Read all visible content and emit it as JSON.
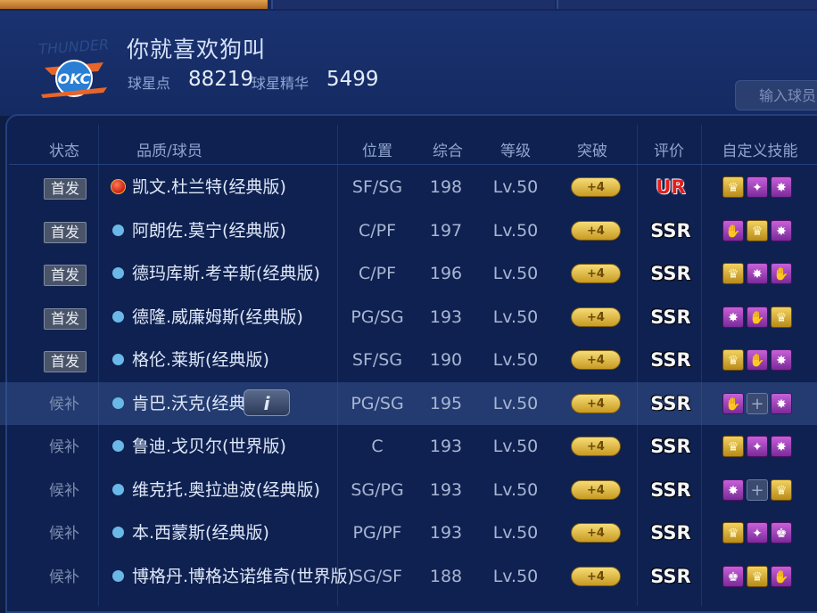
{
  "team": {
    "name": "你就喜欢狗叫",
    "logo_text": "THUNDER OKC",
    "stat1_label": "球星点",
    "stat1_value": "88219",
    "stat2_label": "球星精华",
    "stat2_value": "5499",
    "search_placeholder": "输入球员"
  },
  "columns": [
    "状态",
    "品质/球员",
    "位置",
    "综合",
    "等级",
    "突破",
    "评价",
    "自定义技能"
  ],
  "rows": [
    {
      "status": "首发",
      "quality": "red",
      "name": "凯文.杜兰特(经典版)",
      "pos": "SF/SG",
      "ovr": "198",
      "level": "Lv.50",
      "breakthrough": "+4",
      "rating": "UR",
      "skills": [
        "gold-crown-skill-icon",
        "purple-dunk-skill-icon",
        "purple-dribble-skill-icon"
      ]
    },
    {
      "status": "首发",
      "quality": "blue",
      "name": "阿朗佐.莫宁(经典版)",
      "pos": "C/PF",
      "ovr": "197",
      "level": "Lv.50",
      "breakthrough": "+4",
      "rating": "SSR",
      "skills": [
        "purple-block-skill-icon",
        "gold-crown-skill-icon",
        "purple-dribble-skill-icon"
      ]
    },
    {
      "status": "首发",
      "quality": "blue",
      "name": "德玛库斯.考辛斯(经典版)",
      "pos": "C/PF",
      "ovr": "196",
      "level": "Lv.50",
      "breakthrough": "+4",
      "rating": "SSR",
      "skills": [
        "gold-crown-skill-icon",
        "purple-dribble-skill-icon",
        "purple-block-skill-icon"
      ]
    },
    {
      "status": "首发",
      "quality": "blue",
      "name": "德隆.威廉姆斯(经典版)",
      "pos": "PG/SG",
      "ovr": "193",
      "level": "Lv.50",
      "breakthrough": "+4",
      "rating": "SSR",
      "skills": [
        "purple-dribble-skill-icon",
        "purple-block-skill-icon",
        "gold-crown-skill-icon"
      ]
    },
    {
      "status": "首发",
      "quality": "blue",
      "name": "格伦.莱斯(经典版)",
      "pos": "SF/SG",
      "ovr": "190",
      "level": "Lv.50",
      "breakthrough": "+4",
      "rating": "SSR",
      "skills": [
        "gold-crown-skill-icon",
        "purple-block-skill-icon",
        "purple-dribble-skill-icon"
      ]
    },
    {
      "status": "候补",
      "quality": "blue",
      "name": "肯巴.沃克(经典",
      "pos": "PG/SG",
      "ovr": "195",
      "level": "Lv.50",
      "breakthrough": "+4",
      "rating": "SSR",
      "skills": [
        "purple-block-skill-icon",
        "empty-skill-slot-icon",
        "purple-dribble-skill-icon"
      ],
      "info_button": "i"
    },
    {
      "status": "候补",
      "quality": "blue",
      "name": "鲁迪.戈贝尔(世界版)",
      "pos": "C",
      "ovr": "193",
      "level": "Lv.50",
      "breakthrough": "+4",
      "rating": "SSR",
      "skills": [
        "gold-crown-skill-icon",
        "purple-dunk-skill-icon",
        "purple-dribble-skill-icon"
      ]
    },
    {
      "status": "候补",
      "quality": "blue",
      "name": "维克托.奥拉迪波(经典版)",
      "pos": "SG/PG",
      "ovr": "193",
      "level": "Lv.50",
      "breakthrough": "+4",
      "rating": "SSR",
      "skills": [
        "purple-dribble-skill-icon",
        "empty-skill-slot-icon",
        "gold-crown-skill-icon"
      ]
    },
    {
      "status": "候补",
      "quality": "blue",
      "name": "本.西蒙斯(经典版)",
      "pos": "PG/PF",
      "ovr": "193",
      "level": "Lv.50",
      "breakthrough": "+4",
      "rating": "SSR",
      "skills": [
        "gold-crown-skill-icon",
        "purple-dunk-skill-icon",
        "purple-king-skill-icon"
      ]
    },
    {
      "status": "候补",
      "quality": "blue",
      "name": "博格丹.博格达诺维奇(世界版)",
      "pos": "SG/SF",
      "ovr": "188",
      "level": "Lv.50",
      "breakthrough": "+4",
      "rating": "SSR",
      "skills": [
        "purple-king-skill-icon",
        "gold-crown-skill-icon",
        "purple-block-skill-icon"
      ]
    }
  ]
}
